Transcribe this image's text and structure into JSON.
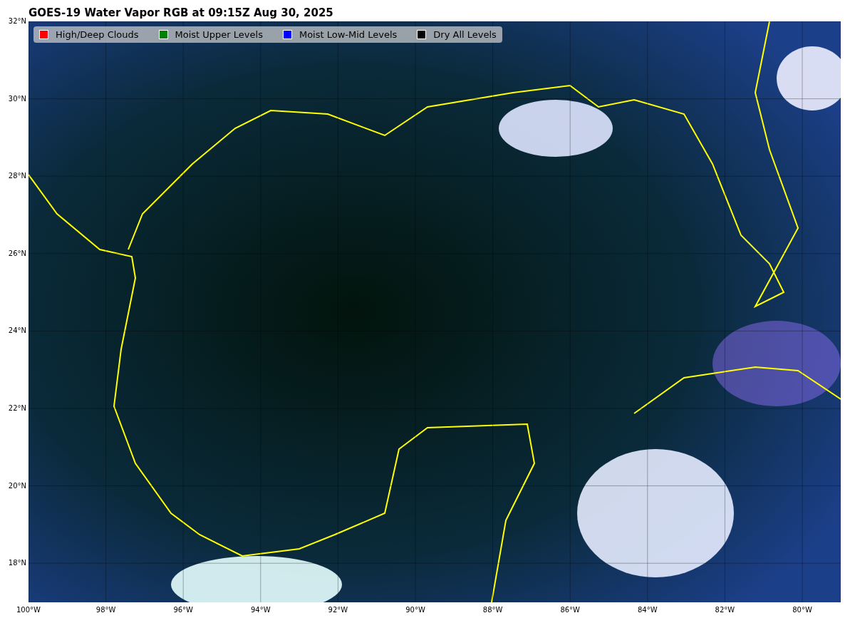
{
  "title": "GOES-19 Water Vapor RGB at 09:15Z Aug 30, 2025",
  "legend": [
    {
      "label": "High/Deep Clouds",
      "color": "#ff0000"
    },
    {
      "label": "Moist Upper Levels",
      "color": "#008000"
    },
    {
      "label": "Moist Low-Mid Levels",
      "color": "#0000ff"
    },
    {
      "label": "Dry All Levels",
      "color": "#000000"
    }
  ],
  "lat_labels": [
    "32°N",
    "30°N",
    "28°N",
    "26°N",
    "24°N",
    "22°N",
    "20°N",
    "18°N"
  ],
  "lon_labels": [
    "100°W",
    "98°W",
    "96°W",
    "94°W",
    "92°W",
    "90°W",
    "88°W",
    "86°W",
    "84°W",
    "82°W",
    "80°W"
  ]
}
